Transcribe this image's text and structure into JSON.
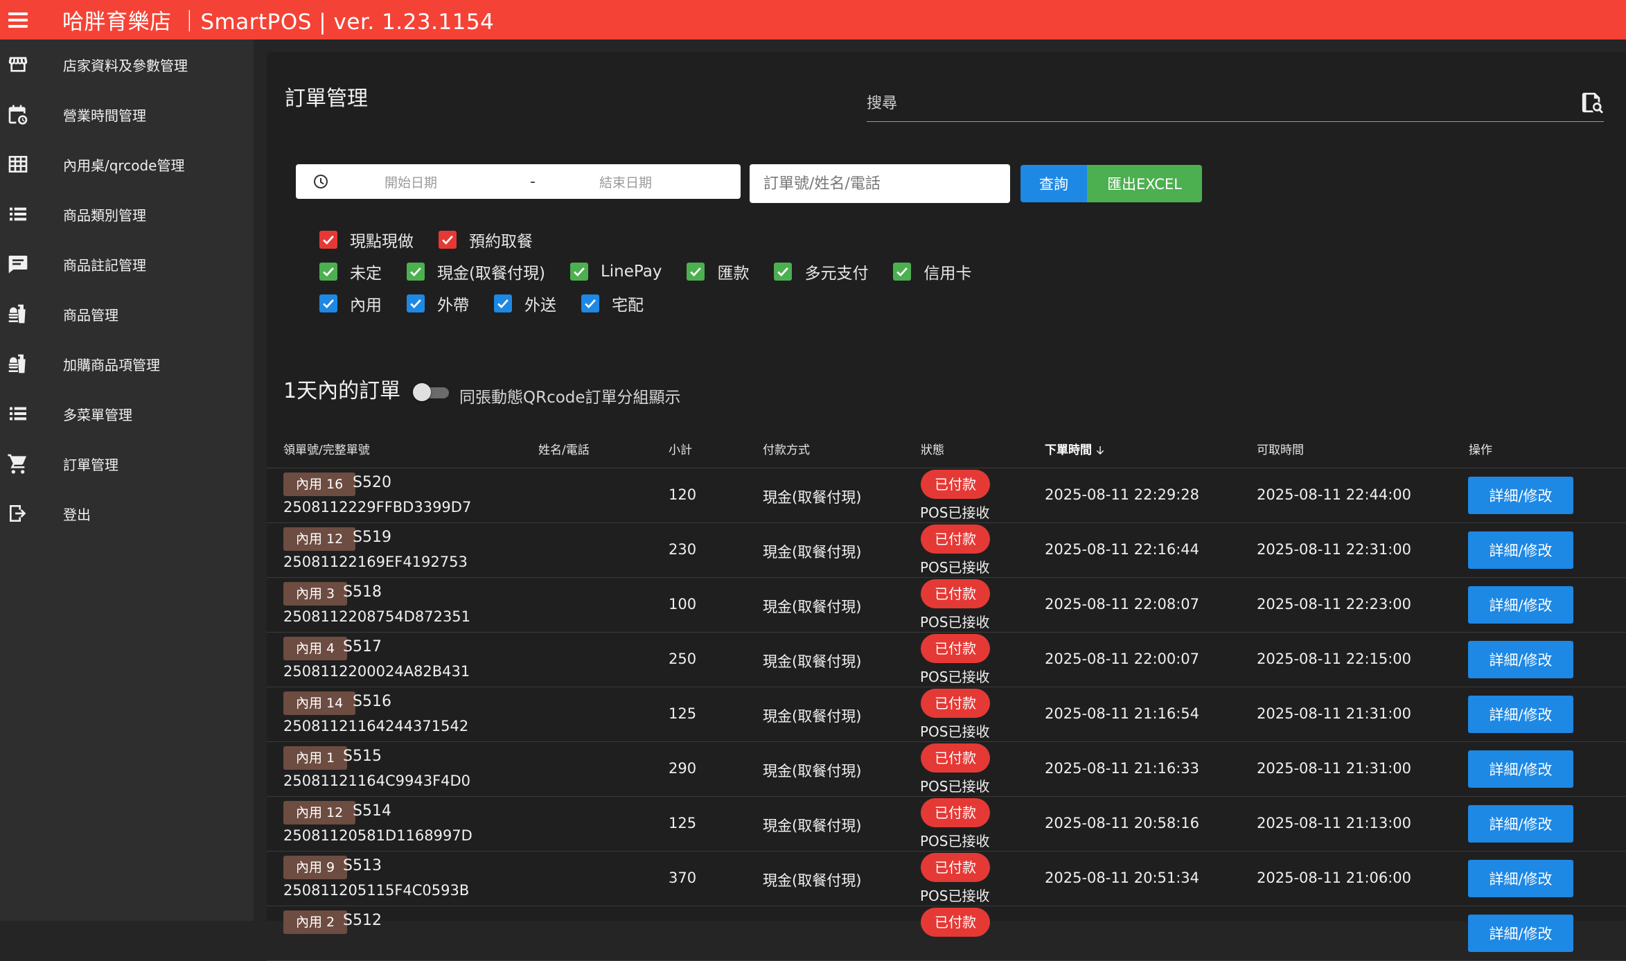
{
  "header": {
    "title": "哈胖育樂店 ｜SmartPOS | ver. 1.23.1154"
  },
  "sidebar": {
    "items": [
      {
        "label": "店家資料及參數管理",
        "icon": "store-icon"
      },
      {
        "label": "營業時間管理",
        "icon": "calendar-clock-icon"
      },
      {
        "label": "內用桌/qrcode管理",
        "icon": "table-grid-icon"
      },
      {
        "label": "商品類別管理",
        "icon": "list-icon"
      },
      {
        "label": "商品註記管理",
        "icon": "comment-icon"
      },
      {
        "label": "商品管理",
        "icon": "food-icon"
      },
      {
        "label": "加購商品項管理",
        "icon": "food-icon"
      },
      {
        "label": "多菜單管理",
        "icon": "list-icon"
      },
      {
        "label": "訂單管理",
        "icon": "cart-icon"
      },
      {
        "label": "登出",
        "icon": "logout-icon"
      }
    ]
  },
  "main": {
    "title": "訂單管理",
    "search_placeholder": "搜尋",
    "date_start_placeholder": "開始日期",
    "date_separator": "-",
    "date_end_placeholder": "結束日期",
    "keyword_placeholder": "訂單號/姓名/電話",
    "query_label": "查詢",
    "excel_label": "匯出EXCEL",
    "colors": {
      "red": "#e53935",
      "green": "#4caf50",
      "blue": "#1e88e5"
    },
    "filters_order_type": [
      "現點現做",
      "預約取餐"
    ],
    "filters_payment": [
      "未定",
      "現金(取餐付現)",
      "LinePay",
      "匯款",
      "多元支付",
      "信用卡"
    ],
    "filters_dine": [
      "內用",
      "外帶",
      "外送",
      "宅配"
    ],
    "section_title": "1天內的訂單",
    "toggle_label": "同張動態QRcode訂單分組顯示",
    "columns": {
      "order_no": "領單號/完整單號",
      "name_phone": "姓名/電話",
      "subtotal": "小計",
      "payment": "付款方式",
      "status": "狀態",
      "order_time": "下單時間",
      "pickup_time": "可取時間",
      "actions": "操作"
    },
    "edit_label": "詳細/修改",
    "orders": [
      {
        "table": "內用 16",
        "short": "S520",
        "full": "2508112229FFBD3399D7",
        "subtotal": "120",
        "payment": "現金(取餐付現)",
        "paid": "已付款",
        "pos": "POS已接收",
        "order_time": "2025-08-11 22:29:28",
        "pickup_time": "2025-08-11 22:44:00"
      },
      {
        "table": "內用 12",
        "short": "S519",
        "full": "25081122169EF4192753",
        "subtotal": "230",
        "payment": "現金(取餐付現)",
        "paid": "已付款",
        "pos": "POS已接收",
        "order_time": "2025-08-11 22:16:44",
        "pickup_time": "2025-08-11 22:31:00"
      },
      {
        "table": "內用 3",
        "short": "S518",
        "full": "2508112208754D872351",
        "subtotal": "100",
        "payment": "現金(取餐付現)",
        "paid": "已付款",
        "pos": "POS已接收",
        "order_time": "2025-08-11 22:08:07",
        "pickup_time": "2025-08-11 22:23:00"
      },
      {
        "table": "內用 4",
        "short": "S517",
        "full": "2508112200024A82B431",
        "subtotal": "250",
        "payment": "現金(取餐付現)",
        "paid": "已付款",
        "pos": "POS已接收",
        "order_time": "2025-08-11 22:00:07",
        "pickup_time": "2025-08-11 22:15:00"
      },
      {
        "table": "內用 14",
        "short": "S516",
        "full": "25081121164244371542",
        "subtotal": "125",
        "payment": "現金(取餐付現)",
        "paid": "已付款",
        "pos": "POS已接收",
        "order_time": "2025-08-11 21:16:54",
        "pickup_time": "2025-08-11 21:31:00"
      },
      {
        "table": "內用 1",
        "short": "S515",
        "full": "25081121164C9943F4D0",
        "subtotal": "290",
        "payment": "現金(取餐付現)",
        "paid": "已付款",
        "pos": "POS已接收",
        "order_time": "2025-08-11 21:16:33",
        "pickup_time": "2025-08-11 21:31:00"
      },
      {
        "table": "內用 12",
        "short": "S514",
        "full": "25081120581D1168997D",
        "subtotal": "125",
        "payment": "現金(取餐付現)",
        "paid": "已付款",
        "pos": "POS已接收",
        "order_time": "2025-08-11 20:58:16",
        "pickup_time": "2025-08-11 21:13:00"
      },
      {
        "table": "內用 9",
        "short": "S513",
        "full": "250811205115F4C0593B",
        "subtotal": "370",
        "payment": "現金(取餐付現)",
        "paid": "已付款",
        "pos": "POS已接收",
        "order_time": "2025-08-11 20:51:34",
        "pickup_time": "2025-08-11 21:06:00"
      },
      {
        "table": "內用 2",
        "short": "S512",
        "full": "",
        "subtotal": "",
        "payment": "",
        "paid": "已付款",
        "pos": "",
        "order_time": "",
        "pickup_time": ""
      }
    ]
  }
}
